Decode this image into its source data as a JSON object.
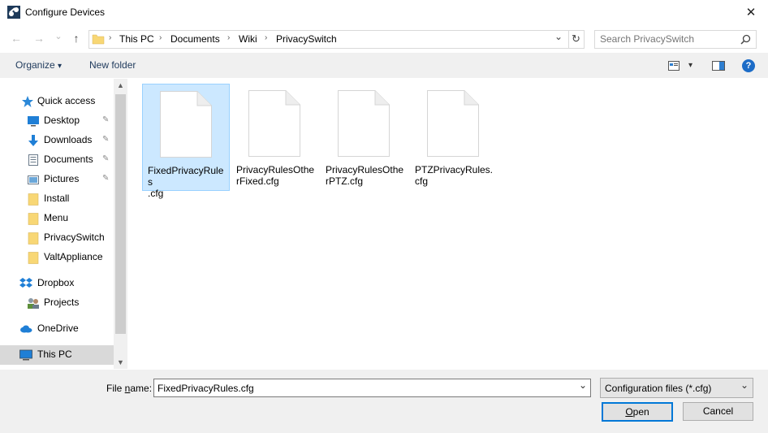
{
  "window": {
    "title": "Configure Devices",
    "close_glyph": "✕"
  },
  "nav": {
    "back_glyph": "←",
    "forward_glyph": "→",
    "recent_glyph": "⌄",
    "up_glyph": "↑",
    "breadcrumbs": [
      "This PC",
      "Documents",
      "Wiki",
      "PrivacySwitch"
    ],
    "sep_glyph": "›",
    "dropdown_glyph": "⌄",
    "refresh_glyph": "↻"
  },
  "search": {
    "placeholder": "Search PrivacySwitch",
    "icon": "search-icon"
  },
  "toolbar": {
    "organize_label": "Organize",
    "caret": "▾",
    "new_folder_label": "New folder",
    "help_glyph": "?"
  },
  "sidebar": {
    "items": [
      {
        "label": "Quick access",
        "icon": "star-icon",
        "pinned": false
      },
      {
        "label": "Desktop",
        "icon": "desktop-icon",
        "pinned": true
      },
      {
        "label": "Downloads",
        "icon": "download-icon",
        "pinned": true
      },
      {
        "label": "Documents",
        "icon": "documents-icon",
        "pinned": true
      },
      {
        "label": "Pictures",
        "icon": "pictures-icon",
        "pinned": true
      },
      {
        "label": "Install",
        "icon": "folder-icon",
        "pinned": false
      },
      {
        "label": "Menu",
        "icon": "folder-icon",
        "pinned": false
      },
      {
        "label": "PrivacySwitch",
        "icon": "folder-icon",
        "pinned": false
      },
      {
        "label": "ValtAppliance",
        "icon": "folder-icon",
        "pinned": false
      },
      {
        "label": "Dropbox",
        "icon": "dropbox-icon",
        "pinned": false
      },
      {
        "label": "Projects",
        "icon": "users-icon",
        "pinned": false
      },
      {
        "label": "OneDrive",
        "icon": "cloud-icon",
        "pinned": false
      },
      {
        "label": "This PC",
        "icon": "computer-icon",
        "pinned": false
      }
    ],
    "pin_glyph": "📌",
    "scroll_up": "▲",
    "scroll_down": "▼"
  },
  "files": [
    {
      "name": "FixedPrivacyRules.cfg",
      "line1": "FixedPrivacyRules",
      "line2": ".cfg",
      "selected": true
    },
    {
      "name": "PrivacyRulesOtherFixed.cfg",
      "line1": "PrivacyRulesOthe",
      "line2": "rFixed.cfg",
      "selected": false
    },
    {
      "name": "PrivacyRulesOtherPTZ.cfg",
      "line1": "PrivacyRulesOthe",
      "line2": "rPTZ.cfg",
      "selected": false
    },
    {
      "name": "PTZPrivacyRules.cfg",
      "line1": "PTZPrivacyRules.",
      "line2": "cfg",
      "selected": false
    }
  ],
  "bottom": {
    "file_name_label_pre": "File ",
    "file_name_label_u": "n",
    "file_name_label_post": "ame:",
    "file_name_value": "FixedPrivacyRules.cfg",
    "file_type_value": "Configuration files (*.cfg)",
    "dropdown_glyph": "⌄",
    "open_u": "O",
    "open_rest": "pen",
    "cancel_label": "Cancel"
  },
  "colors": {
    "accent": "#0078d7",
    "selection": "#cce8ff",
    "folder": "#f8d775"
  }
}
